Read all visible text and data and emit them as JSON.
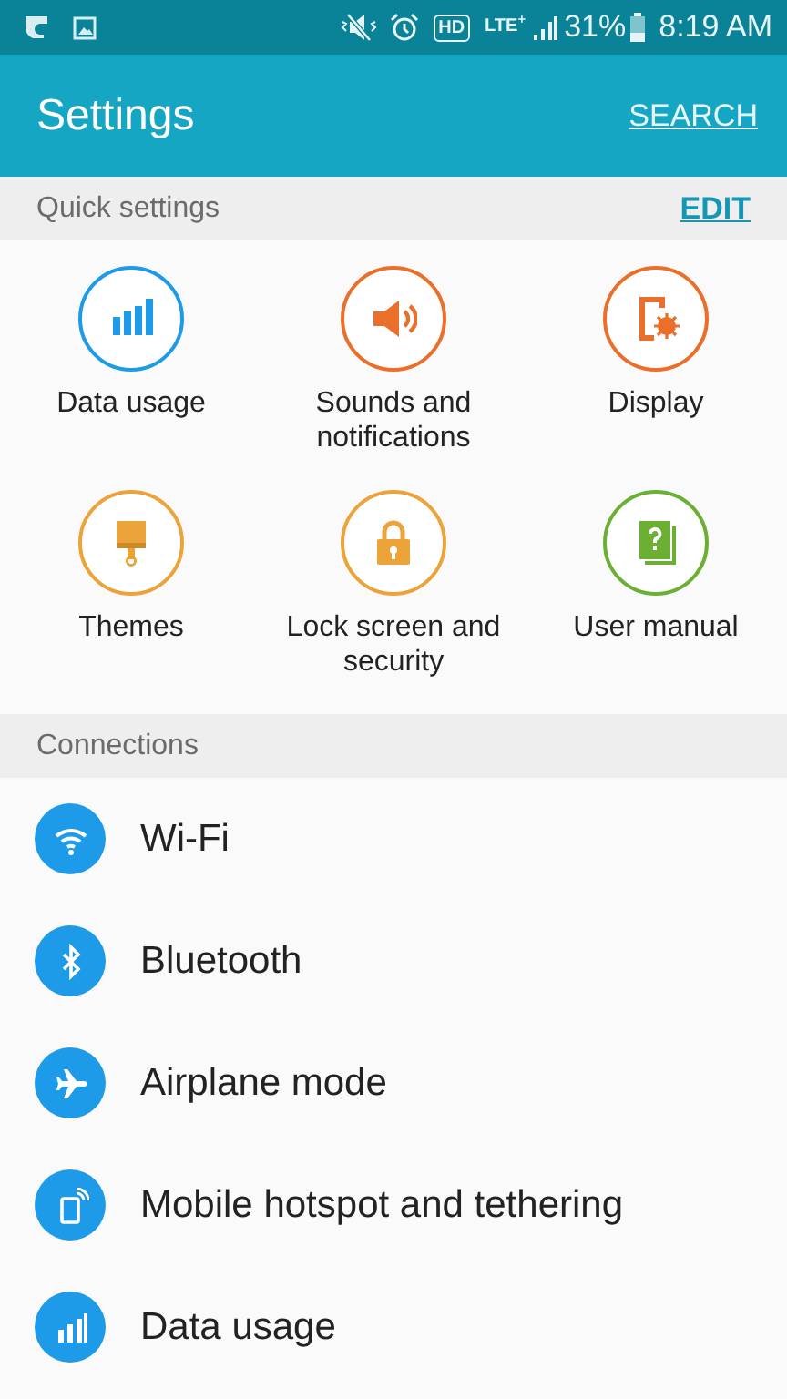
{
  "status_bar": {
    "hd": "HD",
    "network": "LTE$^{+}$",
    "battery": "31%",
    "time": "8:19 AM"
  },
  "app_bar": {
    "title": "Settings",
    "action": "SEARCH"
  },
  "quick_settings": {
    "title": "Quick settings",
    "action": "EDIT",
    "items": [
      {
        "label": "Data usage",
        "kind": "bars",
        "color": "#1e9be8"
      },
      {
        "label": "Sounds and notifications",
        "kind": "speaker",
        "color": "#ea6f2a"
      },
      {
        "label": "Display",
        "kind": "display",
        "color": "#ea6f2a"
      },
      {
        "label": "Themes",
        "kind": "brush",
        "color": "#eca43a"
      },
      {
        "label": "Lock screen and security",
        "kind": "lock",
        "color": "#eca43a"
      },
      {
        "label": "User manual",
        "kind": "book",
        "color": "#6cb033"
      }
    ]
  },
  "connections": {
    "title": "Connections",
    "items": [
      {
        "label": "Wi-Fi",
        "kind": "wifi"
      },
      {
        "label": "Bluetooth",
        "kind": "bluetooth"
      },
      {
        "label": "Airplane mode",
        "kind": "airplane"
      },
      {
        "label": "Mobile hotspot and tethering",
        "kind": "hotspot"
      },
      {
        "label": "Data usage",
        "kind": "bars"
      }
    ]
  }
}
